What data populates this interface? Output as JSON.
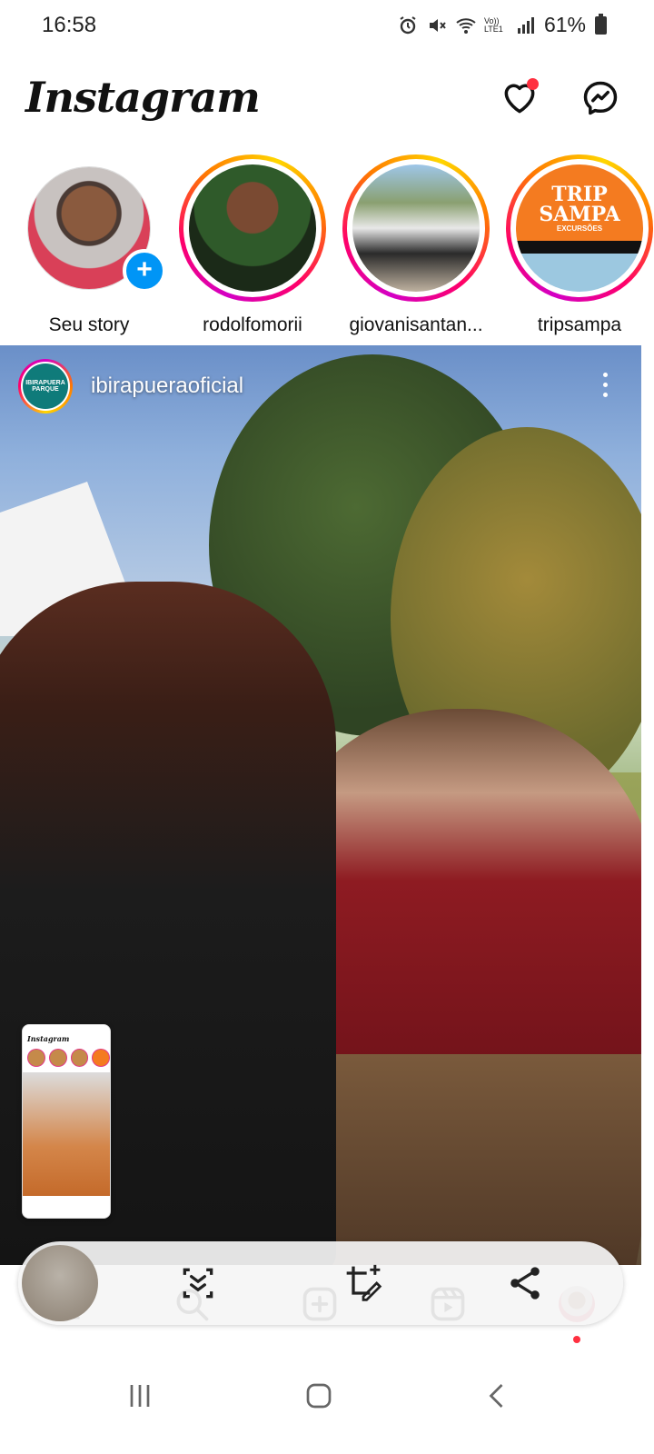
{
  "status_bar": {
    "time": "16:58",
    "battery": "61%",
    "icons": [
      "alarm-icon",
      "mute-icon",
      "wifi-icon",
      "volte-icon",
      "signal-icon",
      "battery-icon"
    ],
    "network_label": "Vo)) LTE1"
  },
  "header": {
    "logo": "Instagram",
    "notification_dot_color": "#ff3040"
  },
  "stories": [
    {
      "label": "Seu story",
      "is_own": true
    },
    {
      "label": "rodolfomorii",
      "is_own": false
    },
    {
      "label": "giovanisantan...",
      "is_own": false
    },
    {
      "label": "tripsampa",
      "is_own": false,
      "logo_line1": "TRIP",
      "logo_line2": "SAMPA",
      "logo_line3": "EXCURSÕES"
    }
  ],
  "post": {
    "username": "ibirapueraoficial",
    "avatar_text": "IBIRAPUERA PARQUE"
  },
  "mini_preview": {
    "logo": "Instagram"
  },
  "ig_nav": {
    "items": [
      "home-icon",
      "search-icon",
      "create-icon",
      "reels-icon",
      "profile-icon"
    ]
  },
  "screenshot_toolbar": {
    "items": [
      "scroll-capture-icon",
      "crop-edit-icon",
      "share-icon"
    ]
  },
  "system_nav": {
    "items": [
      "recents-icon",
      "home-button-icon",
      "back-icon"
    ]
  },
  "colors": {
    "story_ring": "#ff0069",
    "add_badge": "#0095f6",
    "accent_red": "#ff3040"
  }
}
